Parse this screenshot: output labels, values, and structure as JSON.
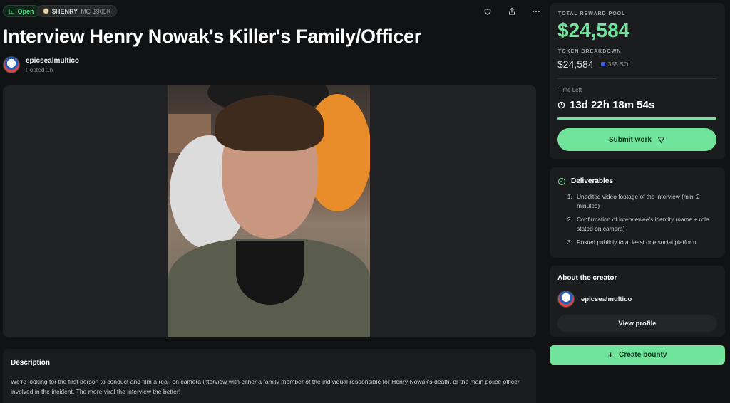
{
  "chips": {
    "status": "Open",
    "token_name": "$HENRY",
    "token_mc": "MC $905K"
  },
  "title": "Interview Henry Nowak's Killer's Family/Officer",
  "author": {
    "name": "epicsealmultico",
    "posted": "Posted 1h"
  },
  "description": {
    "heading": "Description",
    "body": "We're looking for the first person to conduct and film a real, on camera interview with either a family member of the individual responsible for Henry Nowak's death, or the main police officer involved in the incident. The more viral the interview the better!"
  },
  "reward": {
    "label": "TOTAL REWARD POOL",
    "amount": "$24,584",
    "breakdown_label": "TOKEN BREAKDOWN",
    "breakdown_value": "$24,584",
    "sol": "355 SOL",
    "time_left_label": "Time Left",
    "countdown": "13d 22h 18m 54s",
    "progress_fraction": 1.0,
    "submit_label": "Submit work"
  },
  "deliverables": {
    "heading": "Deliverables",
    "items": [
      "Unedited video footage of the interview (min. 2 minutes)",
      "Confirmation of interviewee's identity (name + role stated on camera)",
      "Posted publicly to at least one social platform"
    ]
  },
  "creator": {
    "heading": "About the creator",
    "name": "epicsealmultico",
    "view_profile": "View profile"
  },
  "create_bounty": "Create bounty",
  "colors": {
    "accent": "#6fe49a",
    "background": "#111213",
    "card": "#1b1c1e"
  },
  "icons": [
    "lock-icon",
    "heart-icon",
    "share-icon",
    "more-icon",
    "clock-icon",
    "send-icon",
    "check-circle-icon",
    "plus-icon"
  ]
}
